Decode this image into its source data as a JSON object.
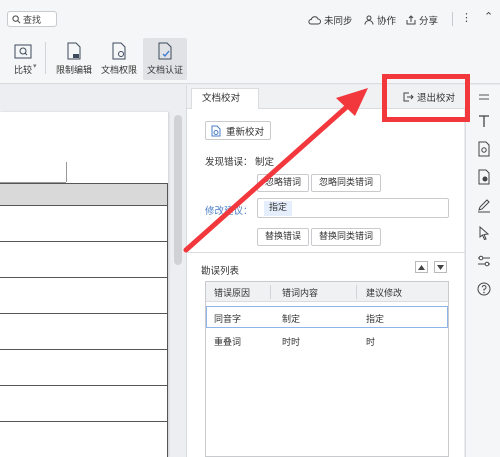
{
  "topbar": {
    "search_label": "查找",
    "unsynced": "未同步",
    "collab": "协作",
    "share": "分享"
  },
  "ribbon": {
    "compare": "比较",
    "restrict_edit": "限制编辑",
    "doc_permission": "文档权限",
    "doc_auth": "文档认证"
  },
  "panel": {
    "tab_title": "文档校对",
    "exit_label": "退出校对",
    "recheck_label": "重新校对",
    "found_error_label": "发现错误：",
    "found_error_value": "制定",
    "ignore_label": "忽略错词",
    "ignore_similar_label": "忽略同类错词",
    "fix_label": "修改建议：",
    "fix_value": "指定",
    "replace_label": "替换错误",
    "replace_similar_label": "替换同类错词",
    "list_title": "勘误列表",
    "table": {
      "headers": [
        "错误原因",
        "错词内容",
        "建议修改"
      ],
      "rows": [
        [
          "同音字",
          "制定",
          "指定"
        ],
        [
          "重叠词",
          "时时",
          "时"
        ]
      ]
    }
  },
  "colors": {
    "annotation_red": "#f2383c",
    "link_blue": "#4a7ec8",
    "selection_blue": "#8fb4ea"
  }
}
